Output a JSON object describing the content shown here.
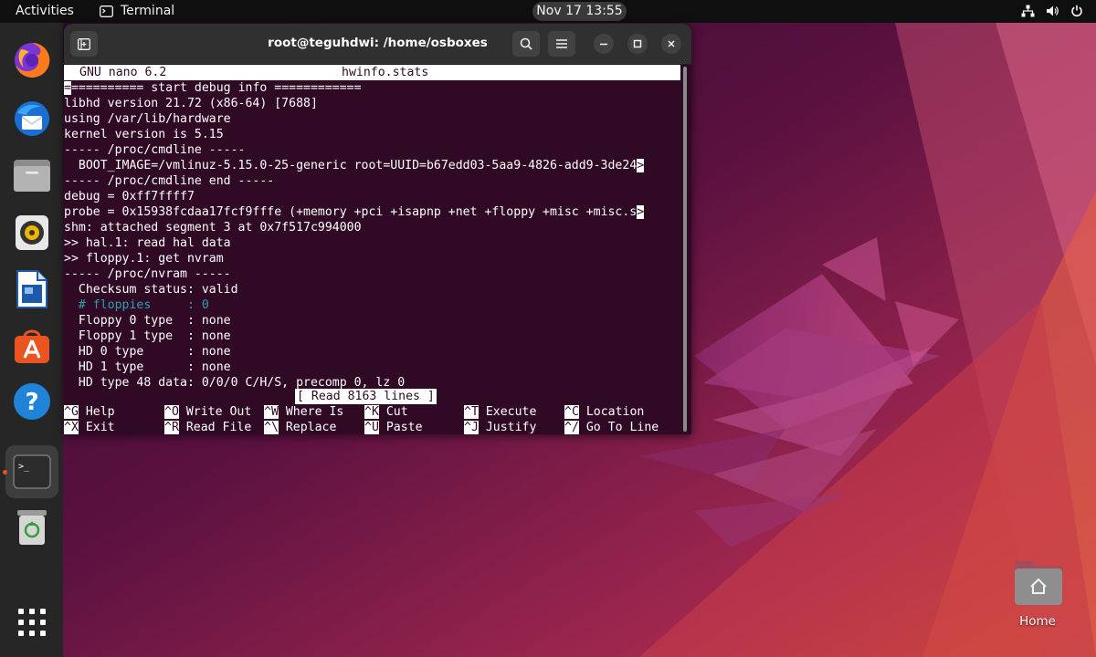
{
  "topbar": {
    "activities": "Activities",
    "app_name": "Terminal",
    "clock": "Nov 17  13:55",
    "tray_icons": [
      "network-icon",
      "volume-icon",
      "power-icon"
    ]
  },
  "dock": {
    "apps": [
      "Firefox",
      "Thunderbird",
      "Files",
      "Rhythmbox",
      "LibreOffice Writer",
      "Ubuntu Software",
      "Help",
      "Terminal",
      "Trash",
      "Show Applications"
    ],
    "running": "Terminal"
  },
  "window": {
    "title": "root@teguhdwi: /home/osboxes",
    "buttons": [
      "new-tab-icon",
      "search-icon",
      "menu-icon",
      "minimize-icon",
      "maximize-icon",
      "close-icon"
    ]
  },
  "nano": {
    "version": "GNU nano 6.2",
    "filename": "hwinfo.stats",
    "lines": [
      "=========== start debug info ============",
      "libhd version 21.72 (x86-64) [7688]",
      "using /var/lib/hardware",
      "kernel version is 5.15",
      "----- /proc/cmdline -----",
      "  BOOT_IMAGE=/vmlinuz-5.15.0-25-generic root=UUID=b67edd03-5aa9-4826-add9-3de24",
      "----- /proc/cmdline end -----",
      "debug = 0xff7ffff7",
      "probe = 0x15938fcdaa17fcf9fffe (+memory +pci +isapnp +net +floppy +misc +misc.s",
      "shm: attached segment 3 at 0x7f517c994000",
      ">> hal.1: read hal data",
      ">> floppy.1: get nvram",
      "----- /proc/nvram -----",
      "  Checksum status: valid",
      "  # floppies     : 0",
      "  Floppy 0 type  : none",
      "  Floppy 1 type  : none",
      "  HD 0 type      : none",
      "  HD 1 type      : none",
      "  HD type 48 data: 0/0/0 C/H/S, precomp 0, lz 0"
    ],
    "truncation_marker": ">",
    "status": "[ Read 8163 lines ]",
    "shortcuts_row1": [
      {
        "key": "^G",
        "label": "Help"
      },
      {
        "key": "^O",
        "label": "Write Out"
      },
      {
        "key": "^W",
        "label": "Where Is"
      },
      {
        "key": "^K",
        "label": "Cut"
      },
      {
        "key": "^T",
        "label": "Execute"
      },
      {
        "key": "^C",
        "label": "Location"
      }
    ],
    "shortcuts_row2": [
      {
        "key": "^X",
        "label": "Exit"
      },
      {
        "key": "^R",
        "label": "Read File"
      },
      {
        "key": "^\\",
        "label": "Replace"
      },
      {
        "key": "^U",
        "label": "Paste"
      },
      {
        "key": "^J",
        "label": "Justify"
      },
      {
        "key": "^/",
        "label": "Go To Line"
      }
    ]
  },
  "desktop": {
    "home_label": "Home"
  },
  "colors": {
    "terminal_bg": "#300a24",
    "accent": "#e95420",
    "comment": "#2aa1b3"
  }
}
